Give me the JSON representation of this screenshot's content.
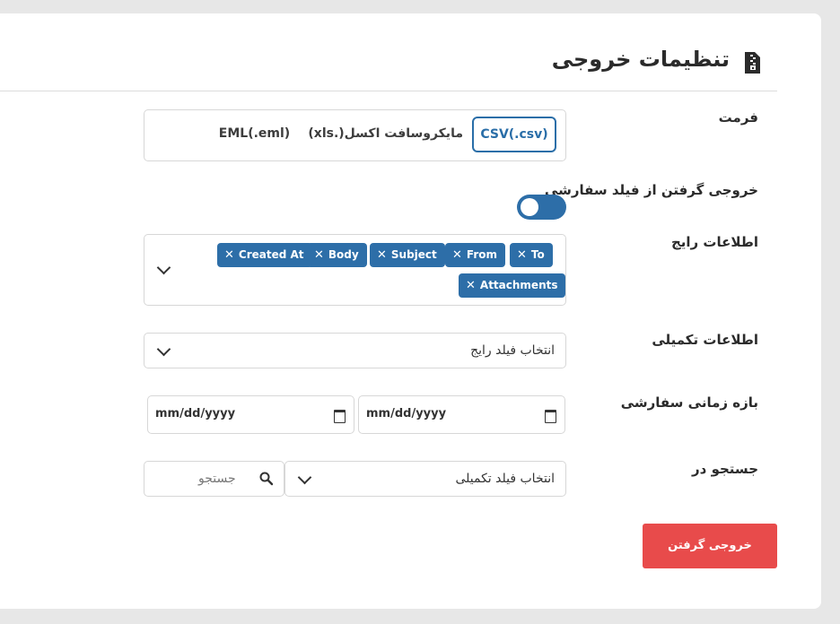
{
  "header": {
    "title": "تنظیمات خروجی",
    "icon": "zip-file-icon"
  },
  "format": {
    "label": "فرمت",
    "options": [
      {
        "label": "CSV(.csv)",
        "active": true
      },
      {
        "label": "مایکروسافت اکسل(.xls)",
        "active": false
      },
      {
        "label": "EML(.eml)",
        "active": false
      }
    ]
  },
  "custom_field": {
    "label": "خروجی گرفتن از فیلد سفارشی",
    "enabled": true
  },
  "common_info": {
    "label": "اطلاعات رایج",
    "tags": [
      "To",
      "From",
      "Subject",
      "Body",
      "Created At",
      "Attachments"
    ],
    "remove_glyph": "✕"
  },
  "extra_info": {
    "label": "اطلاعات تکمیلی",
    "placeholder": "انتخاب فیلد رایج"
  },
  "date_range": {
    "label": "بازه زمانی سفارشی",
    "from": "mm/dd/yyyy",
    "to": "mm/dd/yyyy"
  },
  "search_in": {
    "label": "جستجو در",
    "select_placeholder": "انتخاب فیلد تکمیلی",
    "search_placeholder": "جستجو"
  },
  "export_button": {
    "label": "خروجی گرفتن",
    "color": "#e84b4b"
  },
  "colors": {
    "accent": "#2d6ea8",
    "danger": "#e84b4b"
  }
}
